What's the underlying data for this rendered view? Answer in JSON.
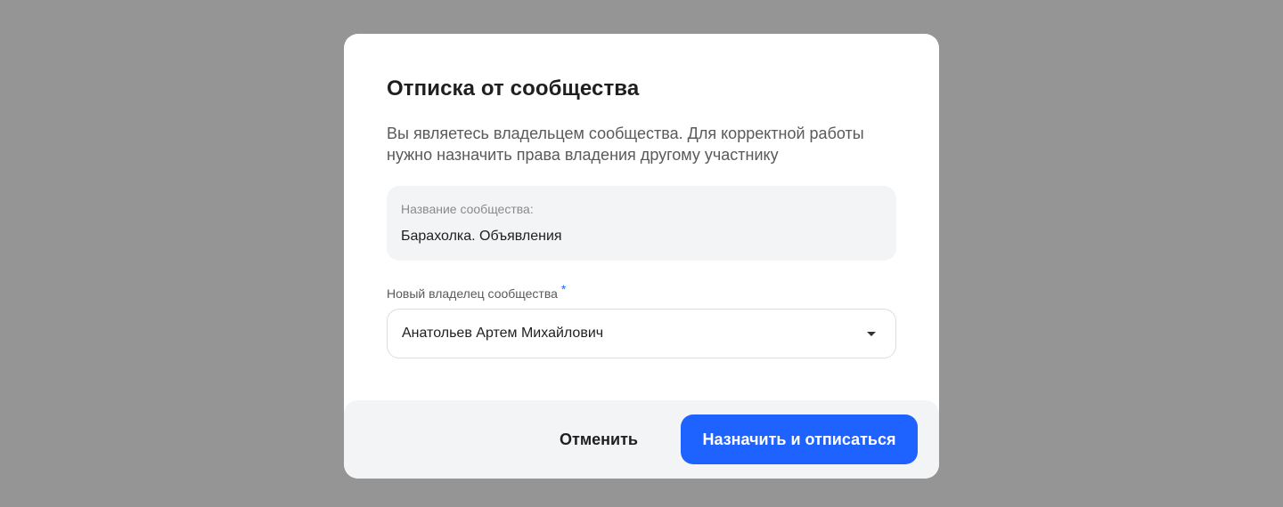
{
  "dialog": {
    "title": "Отписка от сообщества",
    "description": "Вы являетесь владельцем сообщества. Для корректной работы нужно назначить права владения другому участнику",
    "community_name_label": "Название сообщества:",
    "community_name_value": "Барахолка. Объявления",
    "new_owner_label": "Новый владелец сообщества",
    "required_marker": "*",
    "new_owner_value": "Анатольев Артем Михайлович",
    "cancel_label": "Отменить",
    "confirm_label": "Назначить и отписаться"
  },
  "colors": {
    "overlay": "#959595",
    "primary": "#1e63ff",
    "required": "#1e6bff",
    "info_bg": "#f3f4f6"
  }
}
